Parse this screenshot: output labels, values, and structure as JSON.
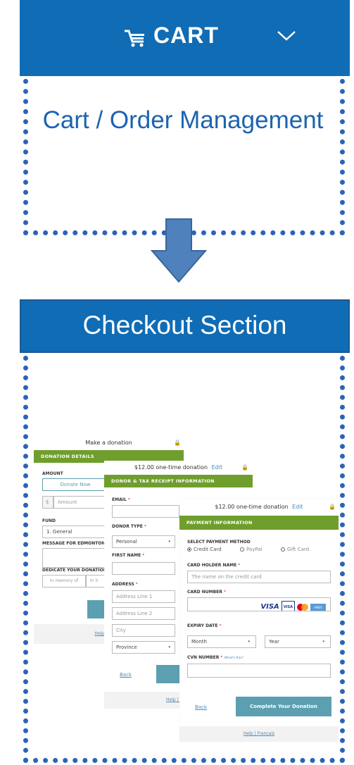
{
  "cart_bar": {
    "label": "CART"
  },
  "cart_box": {
    "title": "Cart / Order Management"
  },
  "checkout": {
    "header": "Checkout Section"
  },
  "form1": {
    "header": "Make a donation",
    "section": "DONATION DETAILS",
    "amount_label": "AMOUNT",
    "donate_now": "Donate Now",
    "currency": "$",
    "amount_placeholder": "Amount",
    "fund_label": "FUND",
    "fund_value": "1. General",
    "message_label": "MESSAGE FOR EDMONTON'S",
    "dedicate_label": "DEDICATE YOUR DONATION",
    "memory_of": "In memory of",
    "honor_partial": "In h",
    "help_partial": "Help"
  },
  "form2": {
    "header": "$12.00 one-time donation",
    "edit": "Edit",
    "section": "DONOR & TAX RECEIPT INFORMATION",
    "email_label": "EMAIL",
    "donor_type_label": "DONOR TYPE",
    "donor_type_value": "Personal",
    "first_name_label": "FIRST NAME",
    "address_label": "ADDRESS",
    "address1": "Address Line 1",
    "address2": "Address Line 2",
    "city": "City",
    "province": "Province",
    "back": "Back",
    "help_partial": "Help | F"
  },
  "form3": {
    "header": "$12.00 one-time donation",
    "edit": "Edit",
    "section": "PAYMENT INFORMATION",
    "method_label": "SELECT PAYMENT METHOD",
    "methods": [
      "Credit Card",
      "PayPal",
      "Gift Card"
    ],
    "holder_label": "CARD HOLDER NAME",
    "holder_placeholder": "The name on the credit card",
    "number_label": "CARD NUMBER",
    "card_visa": "VISA",
    "card_visa_small": "VISA",
    "card_amex": "AMEX",
    "expiry_label": "EXPIRY DATE",
    "month": "Month",
    "year": "Year",
    "cvn_label": "CVN NUMBER",
    "cvn_hint": "What's this?",
    "back": "Back",
    "submit": "Complete Your Donation",
    "footer": "Help | Français"
  },
  "required_mark": "*",
  "colors": {
    "brand_blue": "#0f6cb5",
    "dotted_blue": "#2a64b8",
    "form_green": "#6f9e2d",
    "button_teal": "#5b9fb0"
  }
}
